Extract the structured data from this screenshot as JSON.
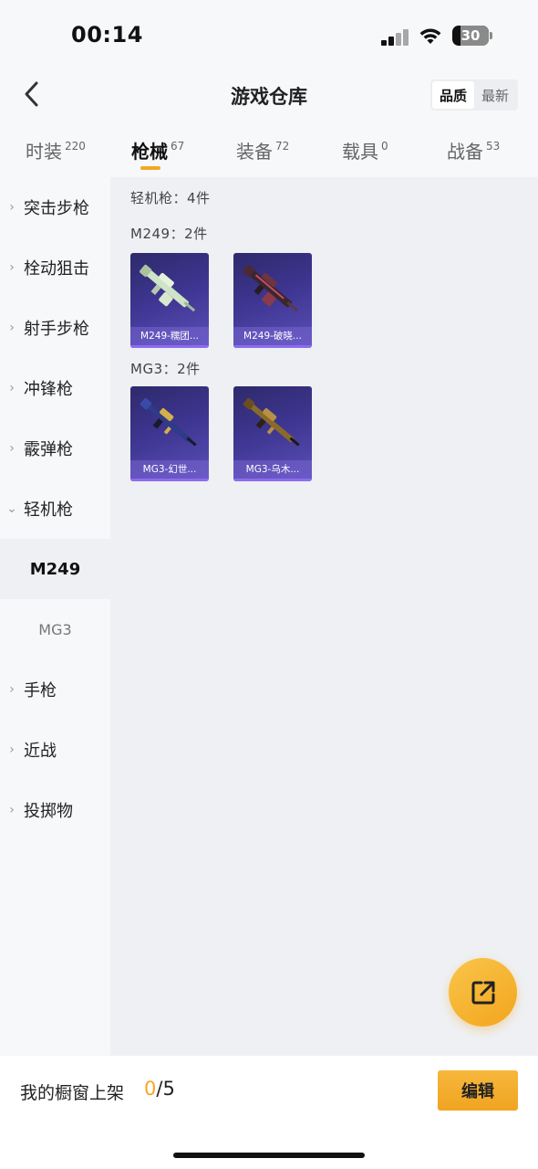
{
  "status_bar": {
    "time": "00:14",
    "battery": "30",
    "icons": [
      "signal-icon",
      "wifi-icon",
      "battery-icon"
    ]
  },
  "header": {
    "back_icon": "chevron-left-icon",
    "title": "游戏仓库",
    "sort": {
      "options": [
        "品质",
        "最新"
      ],
      "active": "品质"
    }
  },
  "tabs": [
    {
      "label": "时装",
      "count": "220"
    },
    {
      "label": "枪械",
      "count": "67"
    },
    {
      "label": "装备",
      "count": "72"
    },
    {
      "label": "载具",
      "count": "0"
    },
    {
      "label": "战备",
      "count": "53"
    }
  ],
  "active_tab": "枪械",
  "sidebar": {
    "categories": [
      {
        "label": "突击步枪",
        "expanded": false
      },
      {
        "label": "栓动狙击",
        "expanded": false
      },
      {
        "label": "射手步枪",
        "expanded": false
      },
      {
        "label": "冲锋枪",
        "expanded": false
      },
      {
        "label": "霰弹枪",
        "expanded": false
      },
      {
        "label": "轻机枪",
        "expanded": true
      },
      {
        "label": "手枪",
        "expanded": false
      },
      {
        "label": "近战",
        "expanded": false
      },
      {
        "label": "投掷物",
        "expanded": false
      }
    ],
    "subcategories": [
      {
        "label": "M249",
        "selected": true
      },
      {
        "label": "MG3",
        "selected": false
      }
    ]
  },
  "content": {
    "category_summary": "轻机枪：4件",
    "groups": [
      {
        "label": "M249：2件",
        "items": [
          "M249-糯团...",
          "M249-破晓..."
        ]
      },
      {
        "label": "MG3：2件",
        "items": [
          "MG3-幻世...",
          "MG3-乌木..."
        ]
      }
    ]
  },
  "fab": {
    "icon": "share-icon"
  },
  "bottom_bar": {
    "shelf_label": "我的橱窗上架",
    "shelf_current": "0",
    "shelf_total": "/5",
    "edit_label": "编辑"
  },
  "colors": {
    "accent": "#f5a623",
    "card_bg": "#3d3590",
    "card_caption": "#7864d2"
  }
}
